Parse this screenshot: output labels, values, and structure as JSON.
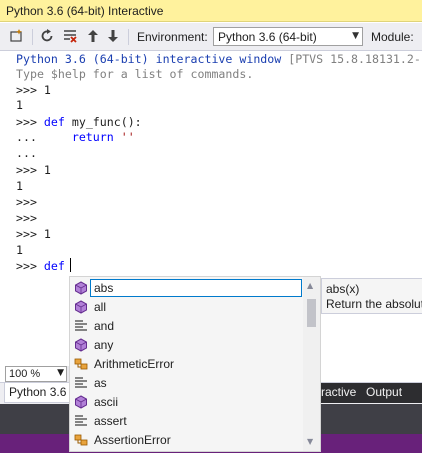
{
  "window": {
    "title": "Python 3.6 (64-bit) Interactive"
  },
  "toolbar": {
    "environment_label": "Environment:",
    "environment_value": "Python 3.6 (64-bit)",
    "module_label": "Module:"
  },
  "console": {
    "lines": [
      {
        "text": "Python 3.6 (64-bit) interactive window",
        "suffix": " [PTVS 15.8.18131.2-"
      },
      {
        "text": "Type $help for a list of commands."
      },
      {
        "prompt": ">>> ",
        "code": "1"
      },
      {
        "output": "1"
      },
      {
        "prompt": ">>> ",
        "kw": "def",
        "code": " my_func():"
      },
      {
        "prompt": "...     ",
        "kw": "return",
        "str": " ''"
      },
      {
        "prompt": "..."
      },
      {
        "prompt": ">>> ",
        "code": "1"
      },
      {
        "output": "1"
      },
      {
        "prompt": ">>>"
      },
      {
        "prompt": ">>>"
      },
      {
        "prompt": ">>> ",
        "code": "1"
      },
      {
        "output": "1"
      },
      {
        "prompt": ">>> ",
        "kw": "def",
        "code": " "
      }
    ]
  },
  "completion": {
    "input_value": "abs",
    "items": [
      {
        "label": "all",
        "icon": "function-icon"
      },
      {
        "label": "and",
        "icon": "keyword-icon"
      },
      {
        "label": "any",
        "icon": "function-icon"
      },
      {
        "label": "ArithmeticError",
        "icon": "class-icon"
      },
      {
        "label": "as",
        "icon": "keyword-icon"
      },
      {
        "label": "ascii",
        "icon": "function-icon"
      },
      {
        "label": "assert",
        "icon": "keyword-icon"
      },
      {
        "label": "AssertionError",
        "icon": "class-icon"
      }
    ]
  },
  "tooltip": {
    "signature": "abs(x)",
    "description": "Return the absolut"
  },
  "zoom": {
    "value": "100 %"
  },
  "tabs": {
    "left": "Python 3.6 (6",
    "right_1": "ractive",
    "right_2": "Output"
  },
  "colors": {
    "title_bg": "#fff29d",
    "accent": "#007acc",
    "status": "#68217a"
  }
}
